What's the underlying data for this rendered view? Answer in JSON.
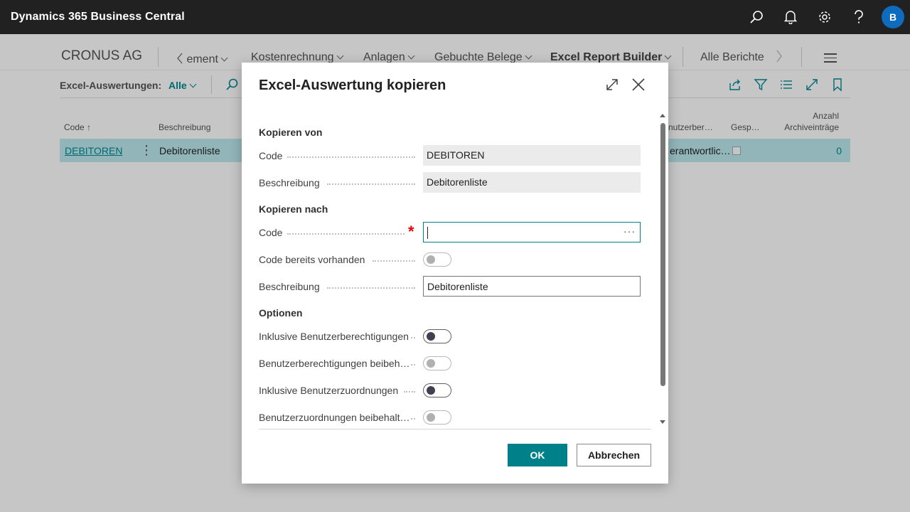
{
  "app": {
    "title": "Dynamics 365 Business Central",
    "user_initial": "B"
  },
  "topbar_icons": [
    "search-icon",
    "bell-icon",
    "gear-icon",
    "help-icon"
  ],
  "nav": {
    "company": "CRONUS AG",
    "items": [
      {
        "label": "ement",
        "back": true
      },
      {
        "label": "Kostenrechnung"
      },
      {
        "label": "Anlagen"
      },
      {
        "label": "Gebuchte Belege"
      },
      {
        "label": "Excel Report Builder",
        "active": true
      },
      {
        "label": "Alle Berichte"
      }
    ]
  },
  "page": {
    "filter_label": "Excel-Auswertungen:",
    "filter_value": "Alle",
    "columns": [
      "Code ↑",
      "Beschreibung",
      "…nutzerber…",
      "Gesp…",
      "Anzahl",
      "Archiveinträge"
    ],
    "rows": [
      {
        "code": "DEBITOREN",
        "description": "Debitorenliste",
        "user_perm": "…erantwortlic…",
        "locked": false,
        "archive_count": "0"
      }
    ]
  },
  "dialog": {
    "title": "Excel-Auswertung kopieren",
    "sections": {
      "from": "Kopieren von",
      "to": "Kopieren nach",
      "options": "Optionen"
    },
    "from": {
      "code_label": "Code",
      "code_value": "DEBITOREN",
      "desc_label": "Beschreibung",
      "desc_value": "Debitorenliste"
    },
    "to": {
      "code_label": "Code",
      "code_value": "",
      "exists_label": "Code bereits vorhanden",
      "exists_value": false,
      "desc_label": "Beschreibung",
      "desc_value": "Debitorenliste"
    },
    "options": [
      {
        "label": "Inklusive Benutzerberechtigungen",
        "enabled": true,
        "value": false
      },
      {
        "label": "Benutzerberechtigungen beibeh…",
        "enabled": false,
        "value": false
      },
      {
        "label": "Inklusive Benutzerzuordnungen",
        "enabled": true,
        "value": false
      },
      {
        "label": "Benutzerzuordnungen beibehalt…",
        "enabled": false,
        "value": false
      }
    ],
    "ok_label": "OK",
    "cancel_label": "Abbrechen",
    "colors": {
      "accent": "#00818a",
      "required": "#e00000"
    }
  }
}
